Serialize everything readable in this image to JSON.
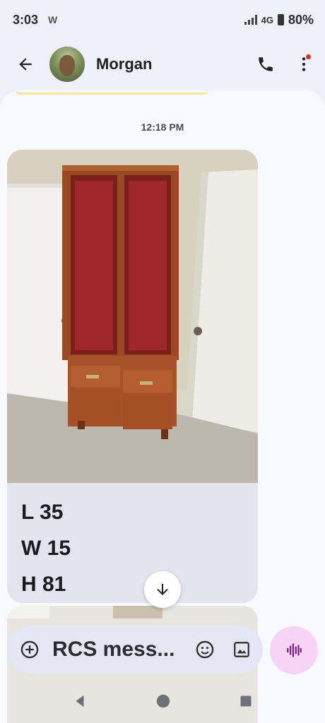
{
  "status_bar": {
    "time": "3:03",
    "notification_glyph": "W",
    "network": "4G",
    "battery": "80%"
  },
  "header": {
    "contact_name": "Morgan",
    "icons": [
      "back-arrow-icon",
      "phone-icon",
      "more-vert-icon"
    ]
  },
  "conversation": {
    "timestamp": "12:18 PM",
    "message": {
      "lines": [
        "L 35",
        "W 15",
        "H 81"
      ]
    }
  },
  "composer": {
    "placeholder": "RCS mess...",
    "icons": [
      "add-icon",
      "emoji-icon",
      "gallery-icon",
      "voice-wave-icon"
    ]
  },
  "colors": {
    "accent_pink": "#f7d3f6",
    "notification_dot": "#d93025",
    "bubble": "#e2e4ee",
    "background": "#eef0f7"
  }
}
